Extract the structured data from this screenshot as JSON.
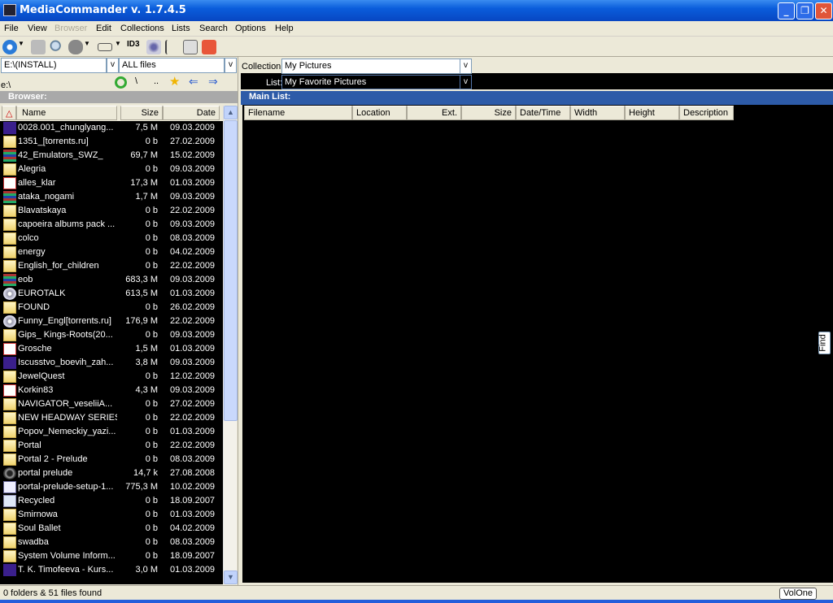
{
  "window": {
    "title": "MediaCommander v. 1.7.4.5",
    "minimize": "_",
    "restore": "❐",
    "close": "✕"
  },
  "menu": [
    "File",
    "View",
    "Browser",
    "Edit",
    "Collections",
    "Lists",
    "Search",
    "Options",
    "Help"
  ],
  "toolbar": {
    "icons": [
      "settings-icon",
      "home-icon",
      "find-duplicates-icon",
      "binoculars-icon",
      "slideshow-icon",
      "id3-icon",
      "music-icon",
      "tree-icon",
      "info-icon",
      "power-icon"
    ],
    "id3_label": "ID3"
  },
  "browser": {
    "path": "E:\\(INSTALL)",
    "filter": "ALL files",
    "dropdown": "v",
    "current_dir": "e:\\",
    "nav_root": "\\",
    "nav_up": "..",
    "caption": "Browser:",
    "columns": {
      "sort": "△",
      "name": "Name",
      "size": "Size",
      "date": "Date"
    },
    "files": [
      {
        "icon": "video",
        "name": "0028.001_chunglyang...",
        "size": "7,5 M",
        "date": "09.03.2009"
      },
      {
        "icon": "folder",
        "name": "1351_[torrents.ru]",
        "size": "0 b",
        "date": "27.02.2009"
      },
      {
        "icon": "rar",
        "name": "42_Emulators_SWZ_",
        "size": "69,7 M",
        "date": "15.02.2009"
      },
      {
        "icon": "folder",
        "name": "Alegria",
        "size": "0 b",
        "date": "09.03.2009"
      },
      {
        "icon": "pdf",
        "name": "alles_klar",
        "size": "17,3 M",
        "date": "01.03.2009"
      },
      {
        "icon": "rar",
        "name": "ataka_nogami",
        "size": "1,7 M",
        "date": "09.03.2009"
      },
      {
        "icon": "folder",
        "name": "Blavatskaya",
        "size": "0 b",
        "date": "22.02.2009"
      },
      {
        "icon": "folder",
        "name": "capoeira albums pack ...",
        "size": "0 b",
        "date": "09.03.2009"
      },
      {
        "icon": "folder",
        "name": "colco",
        "size": "0 b",
        "date": "08.03.2009"
      },
      {
        "icon": "folder",
        "name": "energy",
        "size": "0 b",
        "date": "04.02.2009"
      },
      {
        "icon": "folder",
        "name": "English_for_children",
        "size": "0 b",
        "date": "22.02.2009"
      },
      {
        "icon": "rar",
        "name": "eob",
        "size": "683,3 M",
        "date": "09.03.2009"
      },
      {
        "icon": "cd",
        "name": "EUROTALK",
        "size": "613,5 M",
        "date": "01.03.2009"
      },
      {
        "icon": "folder",
        "name": "FOUND",
        "size": "0 b",
        "date": "26.02.2009"
      },
      {
        "icon": "cd",
        "name": "Funny_Engl[torrents.ru]",
        "size": "176,9 M",
        "date": "22.02.2009"
      },
      {
        "icon": "folder",
        "name": "Gips_ Kings-Roots(20...",
        "size": "0 b",
        "date": "09.03.2009"
      },
      {
        "icon": "pdf",
        "name": "Grosche",
        "size": "1,5 M",
        "date": "01.03.2009"
      },
      {
        "icon": "video",
        "name": "Iscusstvo_boevih_zah...",
        "size": "3,8 M",
        "date": "09.03.2009"
      },
      {
        "icon": "folder",
        "name": "JewelQuest",
        "size": "0 b",
        "date": "12.02.2009"
      },
      {
        "icon": "pdf",
        "name": "Korkin83",
        "size": "4,3 M",
        "date": "09.03.2009"
      },
      {
        "icon": "folder",
        "name": "NAVIGATOR_veseliiA...",
        "size": "0 b",
        "date": "27.02.2009"
      },
      {
        "icon": "folder",
        "name": "NEW HEADWAY SERIES",
        "size": "0 b",
        "date": "22.02.2009"
      },
      {
        "icon": "folder",
        "name": "Popov_Nemeckiy_yazi...",
        "size": "0 b",
        "date": "01.03.2009"
      },
      {
        "icon": "folder",
        "name": "Portal",
        "size": "0 b",
        "date": "22.02.2009"
      },
      {
        "icon": "folder",
        "name": "Portal 2 - Prelude",
        "size": "0 b",
        "date": "08.03.2009"
      },
      {
        "icon": "portal",
        "name": "portal prelude",
        "size": "14,7 k",
        "date": "27.08.2008"
      },
      {
        "icon": "app",
        "name": "portal-prelude-setup-1...",
        "size": "775,3 M",
        "date": "10.02.2009"
      },
      {
        "icon": "recycle",
        "name": "Recycled",
        "size": "0 b",
        "date": "18.09.2007"
      },
      {
        "icon": "folder",
        "name": "Smirnowa",
        "size": "0 b",
        "date": "01.03.2009"
      },
      {
        "icon": "folder",
        "name": "Soul Ballet",
        "size": "0 b",
        "date": "04.02.2009"
      },
      {
        "icon": "folder",
        "name": "swadba",
        "size": "0 b",
        "date": "08.03.2009"
      },
      {
        "icon": "folder",
        "name": "System Volume Inform...",
        "size": "0 b",
        "date": "18.09.2007"
      },
      {
        "icon": "video",
        "name": "T. K. Timofeeva - Kurs...",
        "size": "3,0 M",
        "date": "01.03.2009"
      }
    ]
  },
  "collection": {
    "label": "Collection:",
    "value": "My Pictures",
    "list_label": "List:",
    "list_value": "My Favorite Pictures",
    "dropdown": "v"
  },
  "mainlist": {
    "caption": "Main List:",
    "columns": [
      "Filename",
      "Location",
      "Ext.",
      "Size",
      "Date/Time",
      "Width",
      "Height",
      "Description"
    ],
    "find": "Find"
  },
  "status": {
    "text": "0 folders & 51 files found",
    "volume_button": "VolOne"
  }
}
